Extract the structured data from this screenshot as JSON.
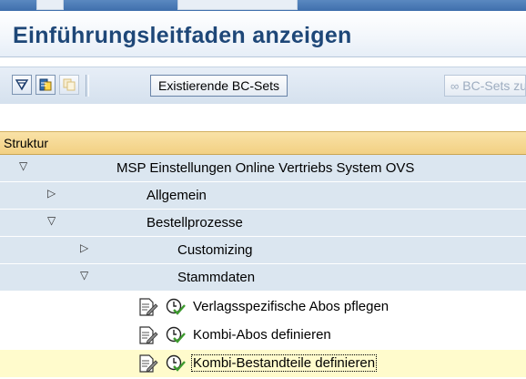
{
  "page": {
    "title": "Einführungsleitfaden anzeigen"
  },
  "toolbar": {
    "icons": [
      "filter-icon",
      "execute-icon",
      "copy-icon"
    ],
    "existing_bc_sets": "Existierende BC-Sets",
    "bc_sets_activity": "BC-Sets zur Akt"
  },
  "tree": {
    "header": "Struktur",
    "rows": [
      {
        "label": "MSP Einstellungen Online Vertriebs System OVS",
        "state": "expanded",
        "level": 0
      },
      {
        "label": "Allgemein",
        "state": "collapsed",
        "level": 1
      },
      {
        "label": "Bestellprozesse",
        "state": "expanded",
        "level": 1
      },
      {
        "label": "Customizing",
        "state": "collapsed",
        "level": 2
      },
      {
        "label": "Stammdaten",
        "state": "expanded",
        "level": 2
      },
      {
        "label": "Verlagsspezifische Abos pflegen",
        "state": "activity",
        "level": 3
      },
      {
        "label": "Kombi-Abos definieren",
        "state": "activity",
        "level": 3
      },
      {
        "label": "Kombi-Bestandteile definieren",
        "state": "activity",
        "level": 3,
        "selected": true
      }
    ]
  },
  "colors": {
    "title": "#1e4778",
    "header_bg": "#f2d083",
    "node_bg": "#dbe6f0",
    "selected_bg": "#fffbcc",
    "clock_green": "#3d9a2e"
  }
}
